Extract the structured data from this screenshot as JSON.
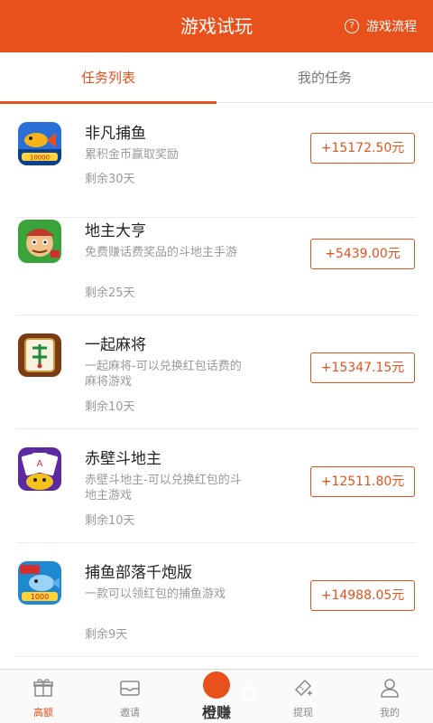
{
  "header": {
    "title": "游戏试玩",
    "help_icon": "question-circle-icon",
    "flow_label": "游戏流程",
    "background": "#e8501c"
  },
  "tabs": [
    {
      "label": "任务列表",
      "active": true
    },
    {
      "label": "我的任务",
      "active": false
    }
  ],
  "accent_color": "#e8501c",
  "tasks": [
    {
      "name": "非凡捕鱼",
      "desc": "累积金币赢取奖励",
      "remaining": "剩余30天",
      "reward": "+15172.50元",
      "icon": "fish-game-icon"
    },
    {
      "name": "地主大亨",
      "desc": "免费赚话费奖品的斗地主手游",
      "remaining": "剩余25天",
      "reward": "+5439.00元",
      "icon": "landlord-game-icon"
    },
    {
      "name": "一起麻将",
      "desc": "一起麻将-可以兑换红包话费的麻将游戏",
      "remaining": "剩余10天",
      "reward": "+15347.15元",
      "icon": "mahjong-game-icon"
    },
    {
      "name": "赤壁斗地主",
      "desc": "赤壁斗地主-可以兑换红包的斗地主游戏",
      "remaining": "剩余10天",
      "reward": "+12511.80元",
      "icon": "poker-game-icon"
    },
    {
      "name": "捕鱼部落千炮版",
      "desc": "一款可以领红包的捕鱼游戏",
      "remaining": "剩余9天",
      "reward": "+14988.05元",
      "icon": "fishing-tribe-icon"
    }
  ],
  "bottom_nav": [
    {
      "label": "高额",
      "icon": "gift-icon",
      "active": true
    },
    {
      "label": "邀请",
      "icon": "envelope-icon",
      "active": false
    },
    {
      "label": "橙赚",
      "icon": "orange-logo-icon",
      "active": false
    },
    {
      "label": "提现",
      "icon": "ticket-icon",
      "active": false
    },
    {
      "label": "我的",
      "icon": "user-icon",
      "active": false
    }
  ]
}
